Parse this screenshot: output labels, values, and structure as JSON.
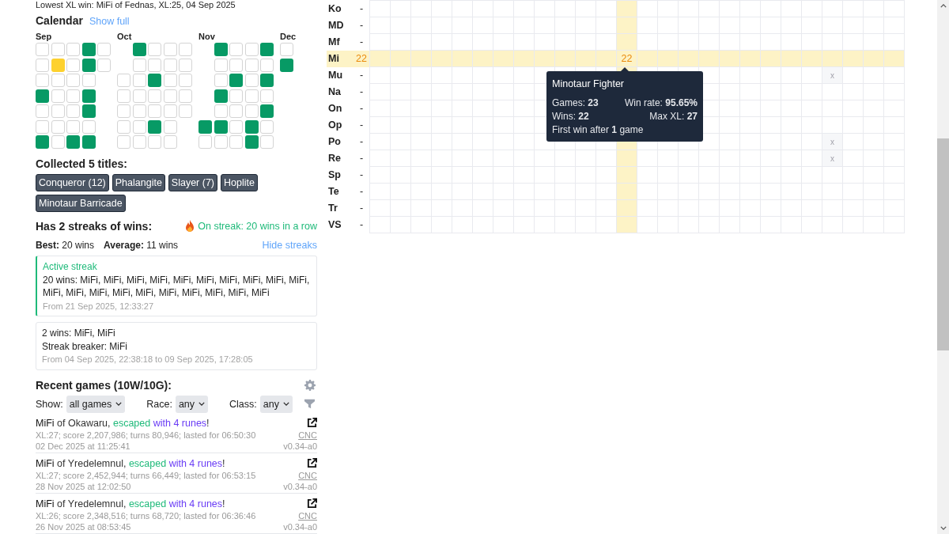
{
  "lowest_xl_win": "Lowest XL win: MiFi of Fednas, XL:25, 04 Sep 2025",
  "calendar": {
    "title": "Calendar",
    "show_full_link": "Show full",
    "months": [
      {
        "label": "Sep",
        "weeks": [
          [
            {
              "kind": "empty"
            },
            {
              "kind": "empty"
            },
            {
              "kind": "empty"
            },
            {
              "kind": "win"
            },
            {
              "kind": "empty"
            },
            {
              "kind": "empty"
            },
            {
              "kind": "win"
            }
          ],
          [
            {
              "kind": "empty"
            },
            {
              "kind": "highlight"
            },
            {
              "kind": "empty"
            },
            {
              "kind": "empty"
            },
            {
              "kind": "empty"
            },
            {
              "kind": "empty"
            },
            {
              "kind": "empty"
            }
          ],
          [
            {
              "kind": "empty"
            },
            {
              "kind": "empty"
            },
            {
              "kind": "empty"
            },
            {
              "kind": "empty"
            },
            {
              "kind": "empty"
            },
            {
              "kind": "empty"
            },
            {
              "kind": "win"
            }
          ],
          [
            {
              "kind": "win"
            },
            {
              "kind": "win"
            },
            {
              "kind": "empty"
            },
            {
              "kind": "win"
            },
            {
              "kind": "win"
            },
            {
              "kind": "empty"
            },
            {
              "kind": "win"
            }
          ],
          [
            {
              "kind": "empty"
            },
            {
              "kind": "empty"
            },
            {
              "kind": "outside"
            },
            {
              "kind": "outside"
            },
            {
              "kind": "outside"
            },
            {
              "kind": "outside"
            },
            {
              "kind": "outside"
            }
          ]
        ]
      },
      {
        "label": "Oct",
        "weeks": [
          [
            {
              "kind": "outside"
            },
            {
              "kind": "outside"
            },
            {
              "kind": "empty"
            },
            {
              "kind": "empty"
            },
            {
              "kind": "empty"
            },
            {
              "kind": "empty"
            },
            {
              "kind": "empty"
            }
          ],
          [
            {
              "kind": "win"
            },
            {
              "kind": "empty"
            },
            {
              "kind": "empty"
            },
            {
              "kind": "empty"
            },
            {
              "kind": "empty"
            },
            {
              "kind": "empty"
            },
            {
              "kind": "empty"
            }
          ],
          [
            {
              "kind": "empty"
            },
            {
              "kind": "empty"
            },
            {
              "kind": "win"
            },
            {
              "kind": "empty"
            },
            {
              "kind": "empty"
            },
            {
              "kind": "win"
            },
            {
              "kind": "empty"
            }
          ],
          [
            {
              "kind": "empty"
            },
            {
              "kind": "empty"
            },
            {
              "kind": "empty"
            },
            {
              "kind": "empty"
            },
            {
              "kind": "empty"
            },
            {
              "kind": "empty"
            },
            {
              "kind": "empty"
            }
          ],
          [
            {
              "kind": "empty"
            },
            {
              "kind": "empty"
            },
            {
              "kind": "empty"
            },
            {
              "kind": "empty"
            },
            {
              "kind": "empty"
            },
            {
              "kind": "outside"
            },
            {
              "kind": "outside"
            }
          ]
        ]
      },
      {
        "label": "Nov",
        "weeks": [
          [
            {
              "kind": "outside"
            },
            {
              "kind": "outside"
            },
            {
              "kind": "outside"
            },
            {
              "kind": "outside"
            },
            {
              "kind": "outside"
            },
            {
              "kind": "win"
            },
            {
              "kind": "empty"
            }
          ],
          [
            {
              "kind": "win"
            },
            {
              "kind": "empty"
            },
            {
              "kind": "empty"
            },
            {
              "kind": "win"
            },
            {
              "kind": "empty"
            },
            {
              "kind": "win"
            },
            {
              "kind": "empty"
            }
          ],
          [
            {
              "kind": "empty"
            },
            {
              "kind": "empty"
            },
            {
              "kind": "win"
            },
            {
              "kind": "empty"
            },
            {
              "kind": "empty"
            },
            {
              "kind": "empty"
            },
            {
              "kind": "empty"
            }
          ],
          [
            {
              "kind": "empty"
            },
            {
              "kind": "empty"
            },
            {
              "kind": "empty"
            },
            {
              "kind": "empty"
            },
            {
              "kind": "empty"
            },
            {
              "kind": "win"
            },
            {
              "kind": "win"
            }
          ],
          [
            {
              "kind": "win"
            },
            {
              "kind": "empty"
            },
            {
              "kind": "win"
            },
            {
              "kind": "empty"
            },
            {
              "kind": "win"
            },
            {
              "kind": "empty"
            },
            {
              "kind": "empty"
            }
          ]
        ]
      },
      {
        "label": "Dec",
        "weeks": [
          [
            {
              "kind": "empty"
            },
            {
              "kind": "win"
            },
            {
              "kind": "outside"
            },
            {
              "kind": "outside"
            },
            {
              "kind": "outside"
            },
            {
              "kind": "outside"
            },
            {
              "kind": "outside"
            }
          ]
        ]
      }
    ]
  },
  "titles": {
    "heading": "Collected 5 titles:",
    "items": [
      "Conqueror (12)",
      "Phalangite",
      "Slayer (7)",
      "Hoplite",
      "Minotaur Barricade"
    ]
  },
  "streaks": {
    "heading": "Has 2 streaks of wins:",
    "on_streak": "On streak: 20 wins in a row",
    "best": "**Best:** 20 wins",
    "average": "**Average:** 11 wins",
    "toggle_link": "Hide streaks",
    "items": [
      {
        "active": true,
        "label": "Active streak",
        "wins": "20 wins: MiFi, MiFi, MiFi, MiFi, MiFi, MiFi, MiFi, MiFi, MiFi, MiFi, MiFi, MiFi, MiFi, MiFi, MiFi, MiFi, MiFi, MiFi, MiFi, MiFi",
        "period": "From 21 Sep 2025, 12:33:27"
      },
      {
        "active": false,
        "wins": "2 wins: MiFi, MiFi",
        "breaker": "Streak breaker: MiFi",
        "period": "From 04 Sep 2025, 22:38:18 to 09 Sep 2025, 17:28:05"
      }
    ]
  },
  "recent_games": {
    "heading": "Recent games (10W/10G):",
    "filters": [
      {
        "label": "Show:",
        "value": "all games"
      },
      {
        "label": "Race:",
        "value": "any"
      },
      {
        "label": "Class:",
        "value": "any"
      }
    ],
    "games": [
      {
        "name": "MiFi",
        "deity": "of Okawaru,",
        "outcome": "escaped",
        "runes": "with 4 runes",
        "suffix": "!",
        "details": "XL:27; score 2,207,986; turns 80,946; lasted for 06:50:30",
        "date": "02 Dec 2025 at 11:25:41",
        "server": "CNC",
        "version": "v0.34-a0"
      },
      {
        "name": "MiFi",
        "deity": "of Yredelemnul,",
        "outcome": "escaped",
        "runes": "with 4 runes",
        "suffix": "!",
        "details": "XL:27; score 2,452,944; turns 66,449; lasted for 06:53:15",
        "date": "28 Nov 2025 at 12:02:50",
        "server": "CNC",
        "version": "v0.34-a0"
      },
      {
        "name": "MiFi",
        "deity": "of Yredelemnul,",
        "outcome": "escaped",
        "runes": "with 4 runes",
        "suffix": "!",
        "details": "XL:26; score 2,348,516; turns 68,720; lasted for 06:36:46",
        "date": "26 Nov 2025 at 08:53:45",
        "server": "CNC",
        "version": "v0.34-a0"
      }
    ]
  },
  "matrix": {
    "columns": [
      {
        "selected": false
      },
      {
        "selected": false
      },
      {
        "selected": false
      },
      {
        "selected": false
      },
      {
        "selected": false
      },
      {
        "selected": false
      },
      {
        "selected": false
      },
      {
        "selected": false
      },
      {
        "selected": false
      },
      {
        "selected": false
      },
      {
        "selected": false
      },
      {
        "selected": false
      },
      {
        "selected": true
      },
      {
        "selected": false
      },
      {
        "selected": false
      },
      {
        "selected": false
      },
      {
        "selected": false
      },
      {
        "selected": false
      },
      {
        "selected": false
      },
      {
        "selected": false
      },
      {
        "selected": false
      },
      {
        "selected": false
      },
      {
        "selected": false
      },
      {
        "selected": false
      },
      {
        "selected": false
      },
      {
        "selected": false
      }
    ],
    "rows": [
      {
        "label": "Ko",
        "total": "-",
        "selected": false,
        "cells": [
          null,
          null,
          null,
          null,
          null,
          null,
          null,
          null,
          null,
          null,
          null,
          null,
          null,
          null,
          null,
          null,
          null,
          null,
          null,
          null,
          null,
          null,
          null,
          null,
          null,
          null
        ]
      },
      {
        "label": "MD",
        "total": "-",
        "selected": false,
        "cells": [
          null,
          null,
          null,
          null,
          null,
          null,
          null,
          null,
          null,
          null,
          null,
          null,
          null,
          null,
          null,
          null,
          null,
          null,
          null,
          null,
          null,
          null,
          null,
          null,
          null,
          null
        ]
      },
      {
        "label": "Mf",
        "total": "-",
        "selected": false,
        "cells": [
          null,
          null,
          null,
          null,
          null,
          null,
          null,
          null,
          null,
          null,
          null,
          null,
          null,
          null,
          null,
          null,
          null,
          null,
          null,
          null,
          null,
          null,
          null,
          null,
          null,
          null
        ]
      },
      {
        "label": "Mi",
        "total": "22",
        "selected": true,
        "cells": [
          null,
          null,
          null,
          null,
          null,
          null,
          null,
          null,
          null,
          null,
          null,
          null,
          {
            "kind": "wins",
            "text": "22"
          },
          null,
          null,
          null,
          null,
          null,
          null,
          null,
          null,
          null,
          null,
          null,
          null,
          null
        ]
      },
      {
        "label": "Mu",
        "total": "-",
        "selected": false,
        "cells": [
          null,
          null,
          null,
          null,
          null,
          null,
          null,
          null,
          null,
          null,
          null,
          null,
          null,
          null,
          null,
          null,
          null,
          null,
          null,
          null,
          null,
          null,
          {
            "kind": "excluded",
            "text": "x"
          },
          null,
          null,
          null
        ]
      },
      {
        "label": "Na",
        "total": "-",
        "selected": false,
        "cells": [
          null,
          null,
          null,
          null,
          null,
          null,
          null,
          null,
          null,
          null,
          null,
          null,
          null,
          null,
          null,
          null,
          null,
          null,
          null,
          null,
          null,
          null,
          null,
          null,
          null,
          null
        ]
      },
      {
        "label": "On",
        "total": "-",
        "selected": false,
        "cells": [
          null,
          null,
          null,
          null,
          null,
          null,
          null,
          null,
          null,
          null,
          null,
          null,
          null,
          null,
          null,
          null,
          null,
          null,
          null,
          null,
          null,
          null,
          null,
          null,
          null,
          null
        ]
      },
      {
        "label": "Op",
        "total": "-",
        "selected": false,
        "cells": [
          null,
          null,
          null,
          null,
          null,
          null,
          null,
          null,
          null,
          null,
          null,
          null,
          null,
          null,
          null,
          null,
          null,
          null,
          null,
          null,
          null,
          null,
          null,
          null,
          null,
          null
        ]
      },
      {
        "label": "Po",
        "total": "-",
        "selected": false,
        "cells": [
          null,
          null,
          null,
          null,
          null,
          null,
          null,
          null,
          null,
          null,
          null,
          null,
          null,
          null,
          null,
          null,
          null,
          null,
          null,
          null,
          null,
          null,
          {
            "kind": "excluded",
            "text": "x"
          },
          null,
          null,
          null
        ]
      },
      {
        "label": "Re",
        "total": "-",
        "selected": false,
        "cells": [
          null,
          null,
          null,
          null,
          null,
          null,
          null,
          null,
          null,
          null,
          null,
          null,
          null,
          null,
          null,
          null,
          null,
          null,
          null,
          null,
          null,
          null,
          {
            "kind": "excluded",
            "text": "x"
          },
          null,
          null,
          null
        ]
      },
      {
        "label": "Sp",
        "total": "-",
        "selected": false,
        "cells": [
          null,
          null,
          null,
          null,
          null,
          null,
          null,
          null,
          null,
          null,
          null,
          null,
          null,
          null,
          null,
          null,
          null,
          null,
          null,
          null,
          null,
          null,
          null,
          null,
          null,
          null
        ]
      },
      {
        "label": "Te",
        "total": "-",
        "selected": false,
        "cells": [
          null,
          null,
          null,
          null,
          null,
          null,
          null,
          null,
          null,
          null,
          null,
          null,
          null,
          null,
          null,
          null,
          null,
          null,
          null,
          null,
          null,
          null,
          null,
          null,
          null,
          null
        ]
      },
      {
        "label": "Tr",
        "total": "-",
        "selected": false,
        "cells": [
          null,
          null,
          null,
          null,
          null,
          null,
          null,
          null,
          null,
          null,
          null,
          null,
          null,
          null,
          null,
          null,
          null,
          null,
          null,
          null,
          null,
          null,
          null,
          null,
          null,
          null
        ]
      },
      {
        "label": "VS",
        "total": "-",
        "selected": false,
        "cells": [
          null,
          null,
          null,
          null,
          null,
          null,
          null,
          null,
          null,
          null,
          null,
          null,
          null,
          null,
          null,
          null,
          null,
          null,
          null,
          null,
          null,
          null,
          null,
          null,
          null,
          null
        ]
      }
    ],
    "tooltip": {
      "title": "Minotaur Fighter",
      "stats": [
        [
          "Games: **23**",
          "Win rate: **95.65%**"
        ],
        [
          "Wins: **22**",
          "Max XL: **27**"
        ]
      ],
      "note": "First win after **1** game"
    }
  }
}
